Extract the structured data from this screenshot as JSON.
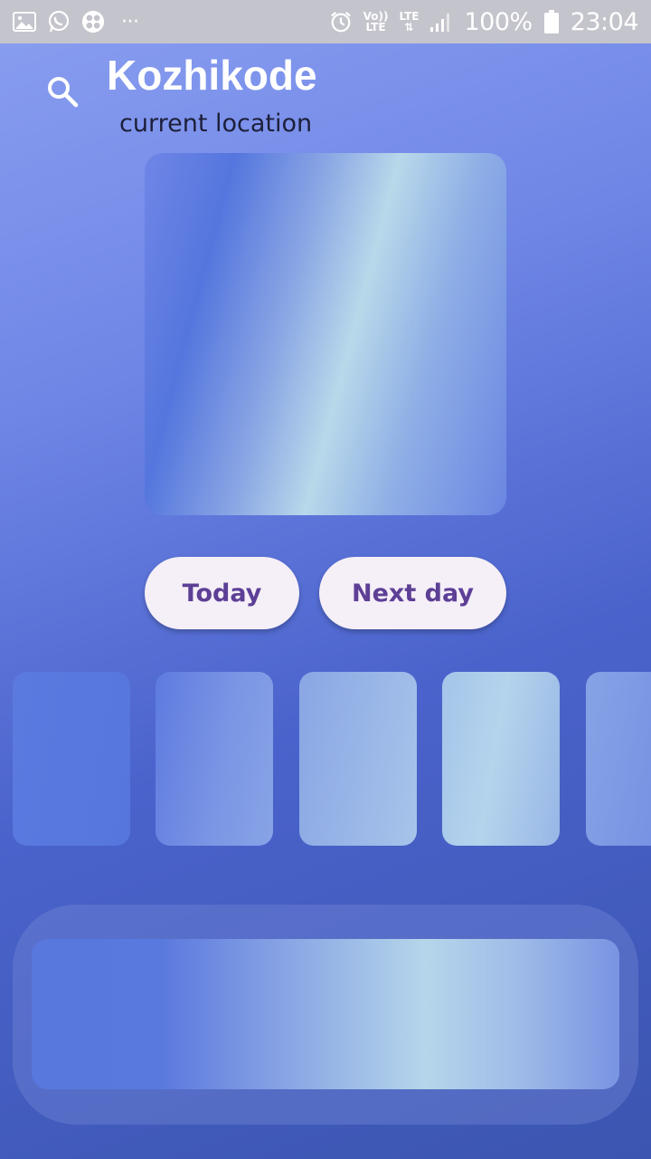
{
  "status_bar": {
    "left_icons": [
      "gallery-icon",
      "whatsapp-icon",
      "app-grid-icon",
      "more-notifications-icon"
    ],
    "more_dots": "···",
    "volte_label_top": "Vo))",
    "volte_label_bottom": "LTE",
    "lte_label": "LTE",
    "battery_percent": "100%",
    "time": "23:04"
  },
  "header": {
    "city": "Kozhikode",
    "subtitle": "current location"
  },
  "tabs": {
    "today_label": "Today",
    "next_day_label": "Next day"
  },
  "colors": {
    "pill_bg": "#f5eff7",
    "pill_text": "#5d3f96",
    "status_bar_bg": "#c4c4cc"
  }
}
